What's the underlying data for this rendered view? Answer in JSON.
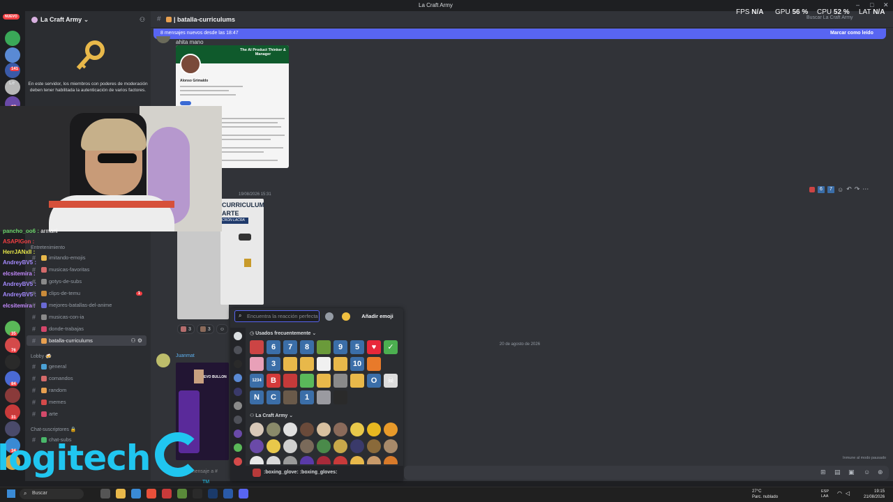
{
  "window": {
    "title": "La Craft Army"
  },
  "top_stats": {
    "fps_label": "FPS",
    "fps_value": "N/A",
    "gpu_label": "GPU",
    "gpu_value": "56 %",
    "cpu_label": "CPU",
    "cpu_value": "52 %",
    "lat_label": "LAT",
    "lat_value": "N/A"
  },
  "search": {
    "placeholder": "Buscar La Craft Army"
  },
  "rail": {
    "nuevo_label": "NUEVO",
    "badges": [
      "141",
      "Le",
      "27",
      "1",
      "35",
      "3",
      "1",
      "76",
      "84",
      "31",
      "2",
      "34",
      "58",
      "6"
    ]
  },
  "sidebar": {
    "server_name": "La Craft Army",
    "auth_text": "En este servidor, los miembros con poderes de moderación deben tener habilitada la autenticación de varios factores.",
    "category_entretenimiento": "Entretenimiento",
    "channels_top": [
      {
        "label": "imitando-emojis",
        "color": "#e8b84a"
      },
      {
        "label": "musicas-favoritas",
        "color": "#d46a6a"
      },
      {
        "label": "gotys-de-subs",
        "color": "#8a8a8a"
      },
      {
        "label": "clips-de-temu",
        "color": "#c98b3a",
        "badge": "1"
      },
      {
        "label": "mejores-batallas-del-anime",
        "color": "#6a6ad4"
      },
      {
        "label": "musicas-con-ia",
        "color": "#8a8a8a"
      },
      {
        "label": "donde-trabajas",
        "color": "#d4466a"
      },
      {
        "label": "batalla-curriculums",
        "color": "#e8a050"
      }
    ],
    "category_lobby": "Lobby 🍻",
    "channels_lobby": [
      {
        "label": "general",
        "color": "#4aa0d4"
      },
      {
        "label": "comandos",
        "color": "#d46a6a"
      },
      {
        "label": "random",
        "color": "#e8a050"
      },
      {
        "label": "memes",
        "color": "#d44a4a"
      },
      {
        "label": "arte",
        "color": "#d44a6a"
      }
    ],
    "category_subs": "Chat-suscriptores 🔒",
    "channel_subs": "chat-subs"
  },
  "channel": {
    "name": "batalla-curriculums"
  },
  "new_messages_bar": {
    "text": "8 mensajes nuevos desde las 18:47",
    "mark_read": "Marcar como leído"
  },
  "messages": {
    "msg1_text": "ahita mano",
    "img1_header": "The AI Product Thinker & Manager",
    "img1_name": "Alonso Grimaldo",
    "msg2_time": "19/08/2026 15:31",
    "img2_title1": "CURRICULUM",
    "img2_title2": "ARTE",
    "img2_band": "CRÓN LACRA",
    "reactions": [
      {
        "count": "3"
      },
      {
        "count": "3"
      }
    ],
    "date_divider": "20 de agosto de 2026",
    "juan_name": "Juanmat",
    "juan_img_text": "EVO BULLON"
  },
  "chat_overlay": [
    {
      "user": "pancho_oo6",
      "msg": "armani",
      "color": "#6ad46a"
    },
    {
      "user": "ASAPIGon",
      "msg": "",
      "color": "#f23f43"
    },
    {
      "user": "HerrJANxII",
      "msg": "",
      "color": "#e8e84a"
    },
    {
      "user": "AndreyBV5",
      "msg": "",
      "color": "#a58aff"
    },
    {
      "user": "elcsitemira",
      "msg": "",
      "color": "#c48aff"
    },
    {
      "user": "AndreyBV5",
      "msg": "",
      "color": "#a58aff"
    },
    {
      "user": "AndreyBV5",
      "msg": "",
      "color": "#a58aff"
    },
    {
      "user": "elcsitemira",
      "msg": "",
      "color": "#c48aff"
    }
  ],
  "emoji_picker": {
    "search_placeholder": "Encuentra la reacción perfecta",
    "add_button": "Añadir emoji",
    "section_frequent": "Usados frecuentemente",
    "section_server": "La Craft Army",
    "frequent": [
      {
        "t": "",
        "c": "#c44"
      },
      {
        "t": "6",
        "c": "key"
      },
      {
        "t": "7",
        "c": "key"
      },
      {
        "t": "8",
        "c": "key"
      },
      {
        "t": "",
        "c": "#6a9a3a"
      },
      {
        "t": "9",
        "c": "key"
      },
      {
        "t": "5",
        "c": "key"
      },
      {
        "t": "♥",
        "c": "#e8283a"
      },
      {
        "t": "✓",
        "c": "#4caf50"
      },
      {
        "t": "",
        "c": "#e8a0b8"
      },
      {
        "t": "3",
        "c": "key"
      },
      {
        "t": "",
        "c": "#e8b84a"
      },
      {
        "t": "",
        "c": "#e8b84a"
      },
      {
        "t": "",
        "c": "#f0f0f0"
      },
      {
        "t": "",
        "c": "#e8b84a"
      },
      {
        "t": "10",
        "c": "key"
      },
      {
        "t": "",
        "c": "#e87a2a"
      },
      {
        "t": "",
        "c": ""
      },
      {
        "t": "1234",
        "c": "key"
      },
      {
        "t": "B",
        "c": "#d43a3a"
      },
      {
        "t": "",
        "c": "#c43a3a"
      },
      {
        "t": "",
        "c": "#5ab85a"
      },
      {
        "t": "",
        "c": "#e8b84a"
      },
      {
        "t": "",
        "c": "#8a8a8a"
      },
      {
        "t": "",
        "c": "#e8b84a"
      },
      {
        "t": "O",
        "c": "key"
      },
      {
        "t": "☠",
        "c": "#ddd"
      },
      {
        "t": "N",
        "c": "key"
      },
      {
        "t": "C",
        "c": "key"
      },
      {
        "t": "",
        "c": "#6a5a4a"
      },
      {
        "t": "1",
        "c": "key"
      },
      {
        "t": "",
        "c": "#9a9aa0"
      },
      {
        "t": "",
        "c": "#2a2a2a"
      }
    ],
    "server": [
      {
        "c": "#d8c8b8"
      },
      {
        "c": "#8a8a6a"
      },
      {
        "c": "#e0e0e0"
      },
      {
        "c": "#6a4a3a"
      },
      {
        "c": "#d8c0a0"
      },
      {
        "c": "#8a6a5a"
      },
      {
        "c": "#e8c84a"
      },
      {
        "c": "#e8b820"
      },
      {
        "c": "#e89a2a"
      },
      {
        "c": "#6a4aa8"
      },
      {
        "c": "#e8c84a"
      },
      {
        "c": "#d0d0d0"
      },
      {
        "c": "#7a6a5a"
      },
      {
        "c": "#4a8a4a"
      },
      {
        "c": "#c8a84a"
      },
      {
        "c": "#3a3a6a"
      },
      {
        "c": "#8a6a3a"
      },
      {
        "c": "#a88a6a"
      },
      {
        "c": "#e8e8e8"
      },
      {
        "c": "#d8d8d8"
      },
      {
        "c": "#9a9a9a"
      },
      {
        "c": "#5a3aa8"
      },
      {
        "c": "#a82a3a"
      },
      {
        "c": "#c83a3a"
      },
      {
        "c": "#e8b84a"
      },
      {
        "c": "#c89a6a"
      },
      {
        "c": "#d87a2a"
      }
    ],
    "footer_text": ":boxing_glove: :boxing_gloves:"
  },
  "chat_input": {
    "placeholder": "Enviar mensaje a #"
  },
  "immune_text": "Inmune al modo pausado",
  "logitech": {
    "word": "logitech",
    "tm": "TM"
  },
  "taskbar": {
    "search_label": "Buscar",
    "weather_temp": "27°C",
    "weather_desc": "Parc. nublado",
    "lang1": "ESP",
    "lang2": "LAA",
    "time": "19:15",
    "date": "21/08/2026"
  }
}
